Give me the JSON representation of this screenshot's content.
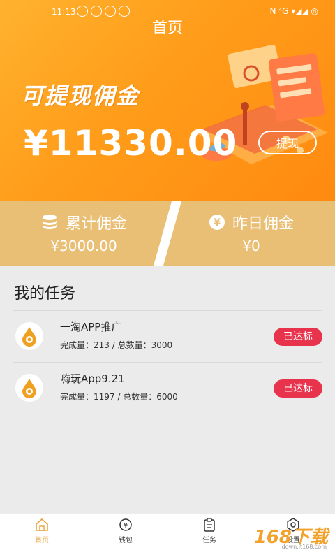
{
  "status": {
    "time": "11:13",
    "right_icons": "N  ⁴G  ▾◢◢  ◎"
  },
  "nav": {
    "title": "首页"
  },
  "hero": {
    "promo_title": "可提现佣金",
    "amount": "¥11330.00",
    "withdraw_label": "提现"
  },
  "stats": {
    "cumulative": {
      "label": "累计佣金",
      "value": "¥3000.00"
    },
    "yesterday": {
      "label": "昨日佣金",
      "value": "¥0"
    }
  },
  "tasks": {
    "title": "我的任务",
    "items": [
      {
        "name": "一淘APP推广",
        "progress": "完成量：213 / 总数量：3000",
        "badge": "已达标"
      },
      {
        "name": "嗨玩App9.21",
        "progress": "完成量：1197 / 总数量：6000",
        "badge": "已达标"
      }
    ]
  },
  "tabbar": {
    "items": [
      {
        "label": "首页",
        "icon": "home-icon"
      },
      {
        "label": "钱包",
        "icon": "wallet-icon"
      },
      {
        "label": "任务",
        "icon": "clipboard-icon"
      },
      {
        "label": "设置",
        "icon": "gear-icon"
      }
    ]
  },
  "watermark": {
    "text": "168下载",
    "sub": "down.it168.com"
  },
  "colors": {
    "hero_orange": "#ff9c1a",
    "stats_bg": "#e9bf76",
    "badge_red": "#e8334d",
    "active_tab": "#e8a33c"
  }
}
